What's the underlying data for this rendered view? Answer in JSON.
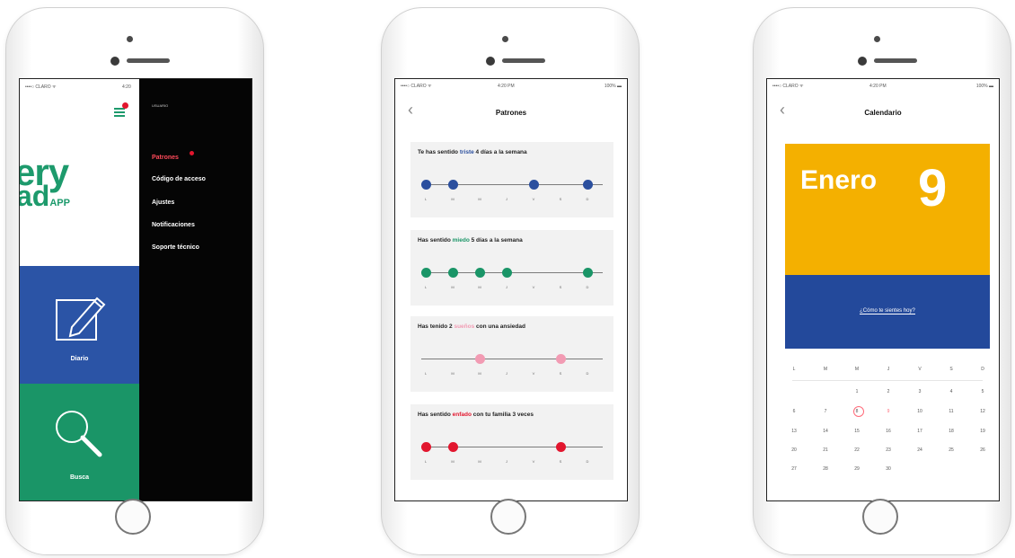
{
  "phone1": {
    "status_left": "••••○ CLARO ᯤ",
    "status_right": "4:20",
    "logo_line1": "ery",
    "logo_line2": "ad",
    "logo_suffix": "APP",
    "menu_header": "USUARIO",
    "menu_items": [
      "Patrones",
      "Código de acceso",
      "Ajustes",
      "Notificaciones",
      "Soporte técnico"
    ],
    "tile_diary": "Diario",
    "tile_search": "Busca",
    "colors": {
      "green": "#1a9567",
      "blue": "#2b54a6",
      "red": "#e2162e"
    },
    "icons": [
      "menu-icon",
      "pencil-note-icon",
      "search-icon"
    ]
  },
  "phone2": {
    "status_left": "••••○ CLARO ᯤ",
    "status_center": "4:20 PM",
    "status_right": "100% ▬",
    "title": "Patrones",
    "cards": [
      {
        "pre": "Te has sentido ",
        "word": "triste",
        "post": " 4 días a la semana",
        "color": "#2b4f9e",
        "days": [
          "L",
          "M",
          "M",
          "J",
          "V",
          "S",
          "D"
        ],
        "marked": [
          0,
          1,
          4,
          6
        ]
      },
      {
        "pre": "Has sentido ",
        "word": "miedo",
        "post": " 5 días a la semana",
        "color": "#1a9567",
        "days": [
          "L",
          "M",
          "M",
          "J",
          "V",
          "S",
          "D"
        ],
        "marked": [
          0,
          1,
          2,
          3,
          6
        ]
      },
      {
        "pre": "Has tenido 2 ",
        "word": "sueños",
        "post": " con una ansiedad",
        "color": "#f29bb3",
        "days": [
          "L",
          "M",
          "M",
          "J",
          "V",
          "S",
          "D"
        ],
        "marked": [
          2,
          5
        ]
      },
      {
        "pre": "Has sentido ",
        "word": "enfado",
        "post": " con tu familia 3 veces",
        "color": "#e2162e",
        "days": [
          "L",
          "M",
          "M",
          "J",
          "V",
          "S",
          "D"
        ],
        "marked": [
          0,
          1,
          5
        ]
      }
    ]
  },
  "phone3": {
    "status_left": "••••○ CLARO ᯤ",
    "status_center": "4:20 PM",
    "status_right": "100% ▬",
    "title": "Calendario",
    "month": "Enero",
    "day": "9",
    "question": "¿Cómo te sientes hoy?",
    "weekdays": [
      "L",
      "M",
      "M",
      "J",
      "V",
      "S",
      "D"
    ],
    "weeks": [
      [
        "",
        "",
        "1",
        "2",
        "3",
        "4",
        "5"
      ],
      [
        "6",
        "7",
        "8",
        "9",
        "10",
        "11",
        "12"
      ],
      [
        "13",
        "14",
        "15",
        "16",
        "17",
        "18",
        "19"
      ],
      [
        "20",
        "21",
        "22",
        "23",
        "24",
        "25",
        "26"
      ],
      [
        "27",
        "28",
        "29",
        "30",
        "",
        "",
        ""
      ]
    ],
    "highlight_day": "9",
    "colors": {
      "yellow": "#f4b000",
      "blue": "#23499b",
      "circle": "#ff6b7a"
    }
  }
}
